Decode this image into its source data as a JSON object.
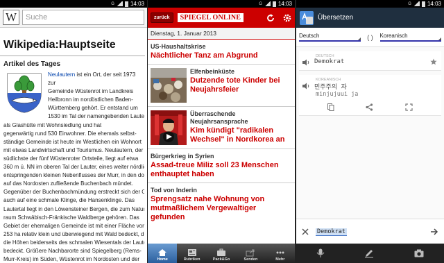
{
  "status": {
    "time": "14:03"
  },
  "wikipedia": {
    "logo_letter": "W",
    "search_placeholder": "Suche",
    "page_title": "Wikipedia:Hauptseite",
    "section_title": "Artikel des Tages",
    "link_word": "Neulautern",
    "lines": [
      "ist ein Ort, der seit 1973 zur",
      "Gemeinde Wüstenrot im Landkreis",
      "Heilbronn im nordöstlichen Baden-",
      "Württemberg gehört. Er entstand um",
      "1530 im Tal der namengebenden Lauter",
      "als Glashütte mit Wohnsiedlung und hat",
      "gegenwärtig rund 530 Einwohner. Die ehemals selbst-",
      "ständige Gemeinde ist heute im Westlichen ein Wohnort",
      "mit etwas Landwirtschaft und Tourismus. Neulautern, der",
      "südlichste der fünf Wüstenroter Ortsteile, liegt auf etwa",
      "360 m ü. NN im oberen Tal der Lauter, eines weiter nördlich",
      "entspringenden kleinen Nebenflusses der Murr, in den dort",
      "auf das Nordosten zufließende Buchenbach mündet.",
      "Gegenüber der Buchenbachmündung erstreckt sich der Ort",
      "auch auf eine schmale Klinge, die Hansenklinge. Das",
      "Lautertal liegt in den Löwensteiner Bergen, die zum Natur-",
      "raum Schwäbisch-Fränkische Waldberge gehören. Das",
      "Gebiet der ehemaligen Gemeinde ist mit einer Fläche von",
      "253 ha relativ klein und überwiegend mit Wald bedeckt, der",
      "die Höhen beiderseits des schmalen Wiesentals der Lauter",
      "bedeckt. Größere Nachbarorte sind Spiegelberg (Rems-",
      "Murr-Kreis) im Süden, Wüstenrot im Nordosten und der"
    ]
  },
  "spiegel": {
    "back_label": "zurück",
    "logo": "SPIEGEL ONLINE",
    "date": "Dienstag, 1. Januar 2013",
    "items": [
      {
        "kicker": "US-Haushaltskrise",
        "headline": "Nächtlicher Tanz am Abgrund"
      },
      {
        "kicker": "Elfenbeinküste",
        "headline": "Dutzende tote Kinder bei Neujahrsfeier"
      },
      {
        "kicker": "Überraschende Neujahrsansprache",
        "headline": "Kim kündigt \"radikalen Wechsel\" in Nordkorea an"
      },
      {
        "kicker": "Bürgerkrieg in Syrien",
        "headline": "Assad-treue Miliz soll 23 Menschen enthauptet haben"
      },
      {
        "kicker": "Tod von Inderin",
        "headline": "Sprengsatz nahe Wohnung von mutmaßlichem Vergewaltiger gefunden"
      }
    ],
    "tabs": [
      "Home",
      "Rubriken",
      "Pack&Go",
      "Senden",
      "Mehr"
    ]
  },
  "translate": {
    "title": "Übersetzen",
    "source_lang": "Deutsch",
    "target_lang": "Koreanisch",
    "swap_label": "( )",
    "source_label": "DEUTSCH",
    "source_text": "Demokrat",
    "target_label": "KOREANISCH",
    "target_text": "민주주의 자",
    "romanization": "minjujuui ja",
    "input_value": "Demokrat"
  }
}
